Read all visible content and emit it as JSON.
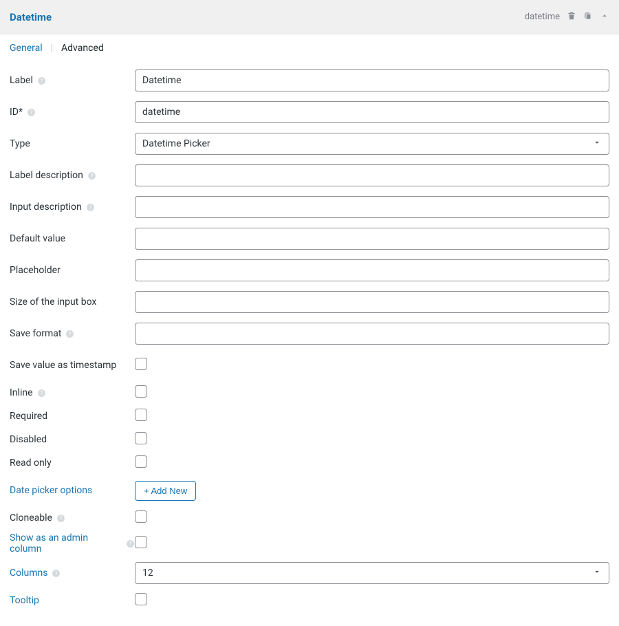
{
  "header": {
    "title": "Datetime",
    "slug": "datetime"
  },
  "tabs": {
    "general": "General",
    "advanced": "Advanced"
  },
  "fields": {
    "label": {
      "label": "Label",
      "value": "Datetime"
    },
    "id": {
      "label": "ID*",
      "value": "datetime"
    },
    "type": {
      "label": "Type",
      "value": "Datetime Picker"
    },
    "label_desc": {
      "label": "Label description",
      "value": ""
    },
    "input_desc": {
      "label": "Input description",
      "value": ""
    },
    "default_value": {
      "label": "Default value",
      "value": ""
    },
    "placeholder": {
      "label": "Placeholder",
      "value": ""
    },
    "size": {
      "label": "Size of the input box",
      "value": ""
    },
    "save_format": {
      "label": "Save format",
      "value": ""
    },
    "save_ts": {
      "label": "Save value as timestamp"
    },
    "inline": {
      "label": "Inline"
    },
    "required": {
      "label": "Required"
    },
    "disabled": {
      "label": "Disabled"
    },
    "readonly": {
      "label": "Read only"
    },
    "date_options": {
      "label": "Date picker options",
      "button": "+ Add New"
    },
    "cloneable": {
      "label": "Cloneable"
    },
    "admin_col": {
      "label": "Show as an admin column"
    },
    "columns": {
      "label": "Columns",
      "value": "12"
    },
    "tooltip": {
      "label": "Tooltip"
    }
  }
}
